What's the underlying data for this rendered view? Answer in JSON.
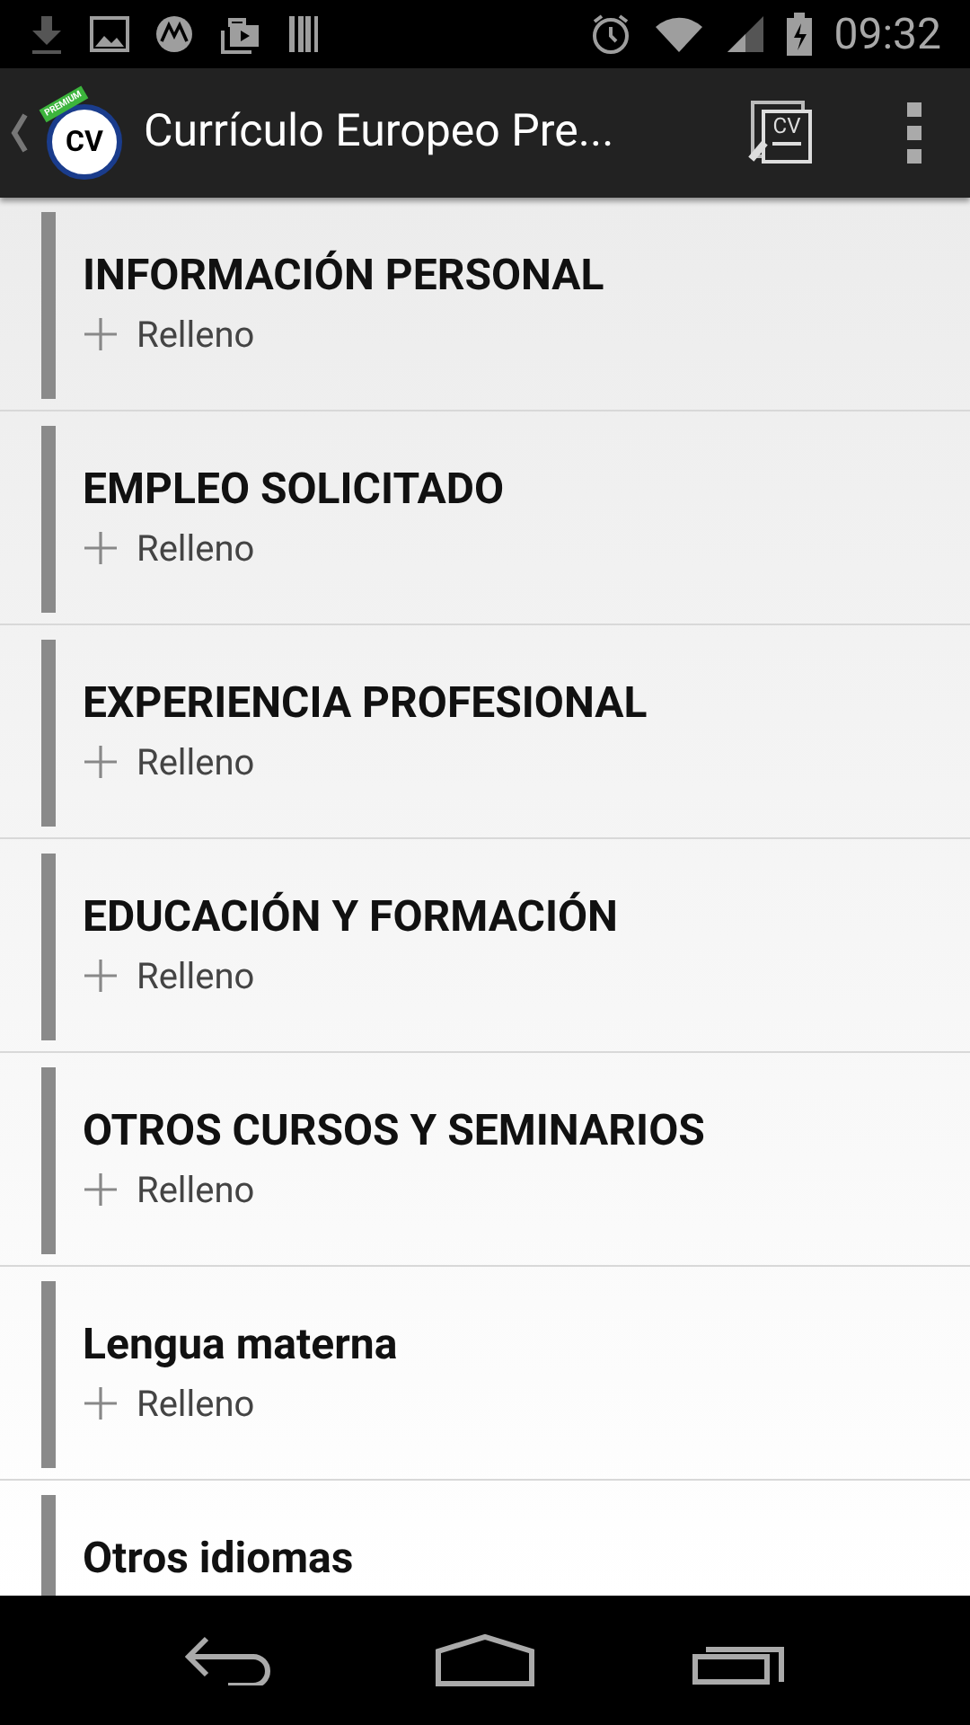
{
  "status_bar": {
    "time": "09:32"
  },
  "action_bar": {
    "logo_text": "CV",
    "logo_badge": "PREMIUM",
    "title": "Currículo Europeo Pre...",
    "cv_button_text": "CV"
  },
  "sections": [
    {
      "title": "INFORMACIÓN PERSONAL",
      "action": "Relleno"
    },
    {
      "title": "EMPLEO SOLICITADO",
      "action": "Relleno"
    },
    {
      "title": "EXPERIENCIA PROFESIONAL",
      "action": "Relleno"
    },
    {
      "title": "EDUCACIÓN Y FORMACIÓN",
      "action": "Relleno"
    },
    {
      "title": "OTROS CURSOS Y SEMINARIOS",
      "action": "Relleno"
    },
    {
      "title": "Lengua materna",
      "action": "Relleno"
    },
    {
      "title": "Otros idiomas"
    }
  ]
}
